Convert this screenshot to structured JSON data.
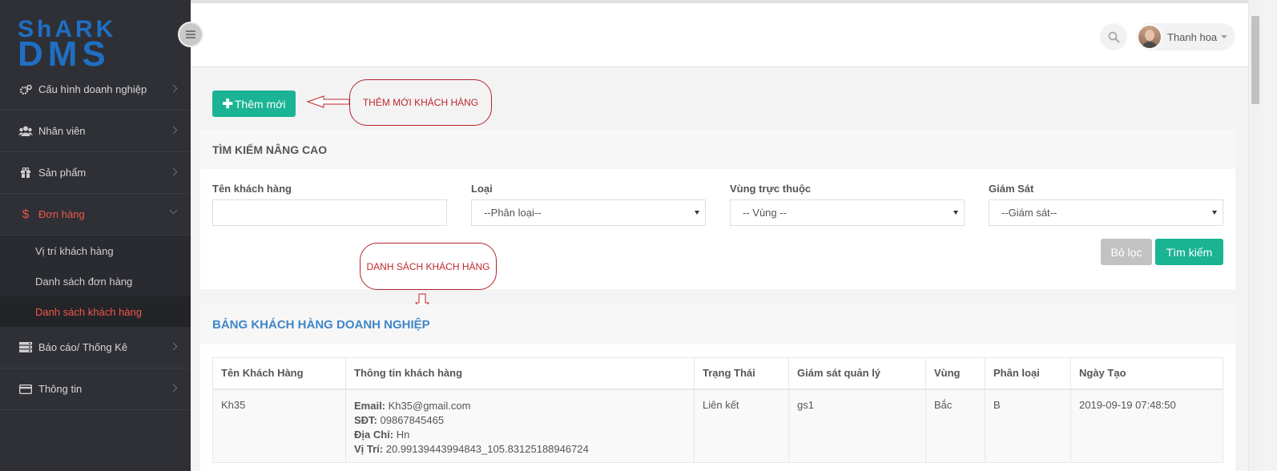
{
  "sidebar": {
    "logo_top": "ShARK",
    "logo_bottom": "DMS",
    "items": [
      {
        "label": "Cấu hình doanh nghiệp",
        "icon": "cogs-icon"
      },
      {
        "label": "Nhân viên",
        "icon": "users-icon"
      },
      {
        "label": "Sản phẩm",
        "icon": "gift-icon"
      },
      {
        "label": "Đơn hàng",
        "icon": "dollar-icon",
        "active": true
      }
    ],
    "sub_items": [
      {
        "label": "Vị trí khách hàng"
      },
      {
        "label": "Danh sách đơn hàng"
      },
      {
        "label": "Danh sách khách hàng",
        "active": true
      }
    ],
    "items_after": [
      {
        "label": "Báo cáo/ Thống Kê",
        "icon": "server-icon"
      },
      {
        "label": "Thông tin",
        "icon": "credit-card-icon"
      }
    ]
  },
  "header": {
    "user_name": "Thanh hoa"
  },
  "toolbar": {
    "add_plus": "✚",
    "add_label": "Thêm mới"
  },
  "annotations": {
    "add_customer": "THÊM MỚI KHÁCH HÀNG",
    "customer_list": "DANH SÁCH KHÁCH HÀNG"
  },
  "search": {
    "title": "TÌM KIẾM NÂNG CAO",
    "fields": {
      "name_label": "Tên khách hàng",
      "type_label": "Loại",
      "type_value": "--Phân loại--",
      "region_label": "Vùng trực thuộc",
      "region_value": "-- Vùng --",
      "supervisor_label": "Giám Sát",
      "supervisor_value": "--Giám sát--"
    },
    "reset_label": "Bỏ lọc",
    "search_label": "Tìm kiếm"
  },
  "table": {
    "title": "BẢNG KHÁCH HÀNG DOANH NGHIỆP",
    "headers": [
      "Tên Khách Hàng",
      "Thông tin khách hàng",
      "Trạng Thái",
      "Giám sát quản lý",
      "Vùng",
      "Phân loại",
      "Ngày Tạo"
    ],
    "rows": [
      {
        "name": "Kh35",
        "email_label": "Email:",
        "email": "Kh35@gmail.com",
        "phone_label": "SĐT:",
        "phone": "09867845465",
        "address_label": "Địa Chỉ:",
        "address": "Hn",
        "location_label": "Vị Trí:",
        "location": "20.99139443994843_105.83125188946724",
        "status": "Liên kết",
        "supervisor": "gs1",
        "region": "Bắc",
        "type": "B",
        "created": "2019-09-19 07:48:50"
      }
    ]
  },
  "colors": {
    "sidebar_bg": "#2f3035",
    "accent": "#1ab394",
    "active_red": "#f0564a",
    "table_title": "#3f86c7",
    "annotation": "#c0272d"
  }
}
